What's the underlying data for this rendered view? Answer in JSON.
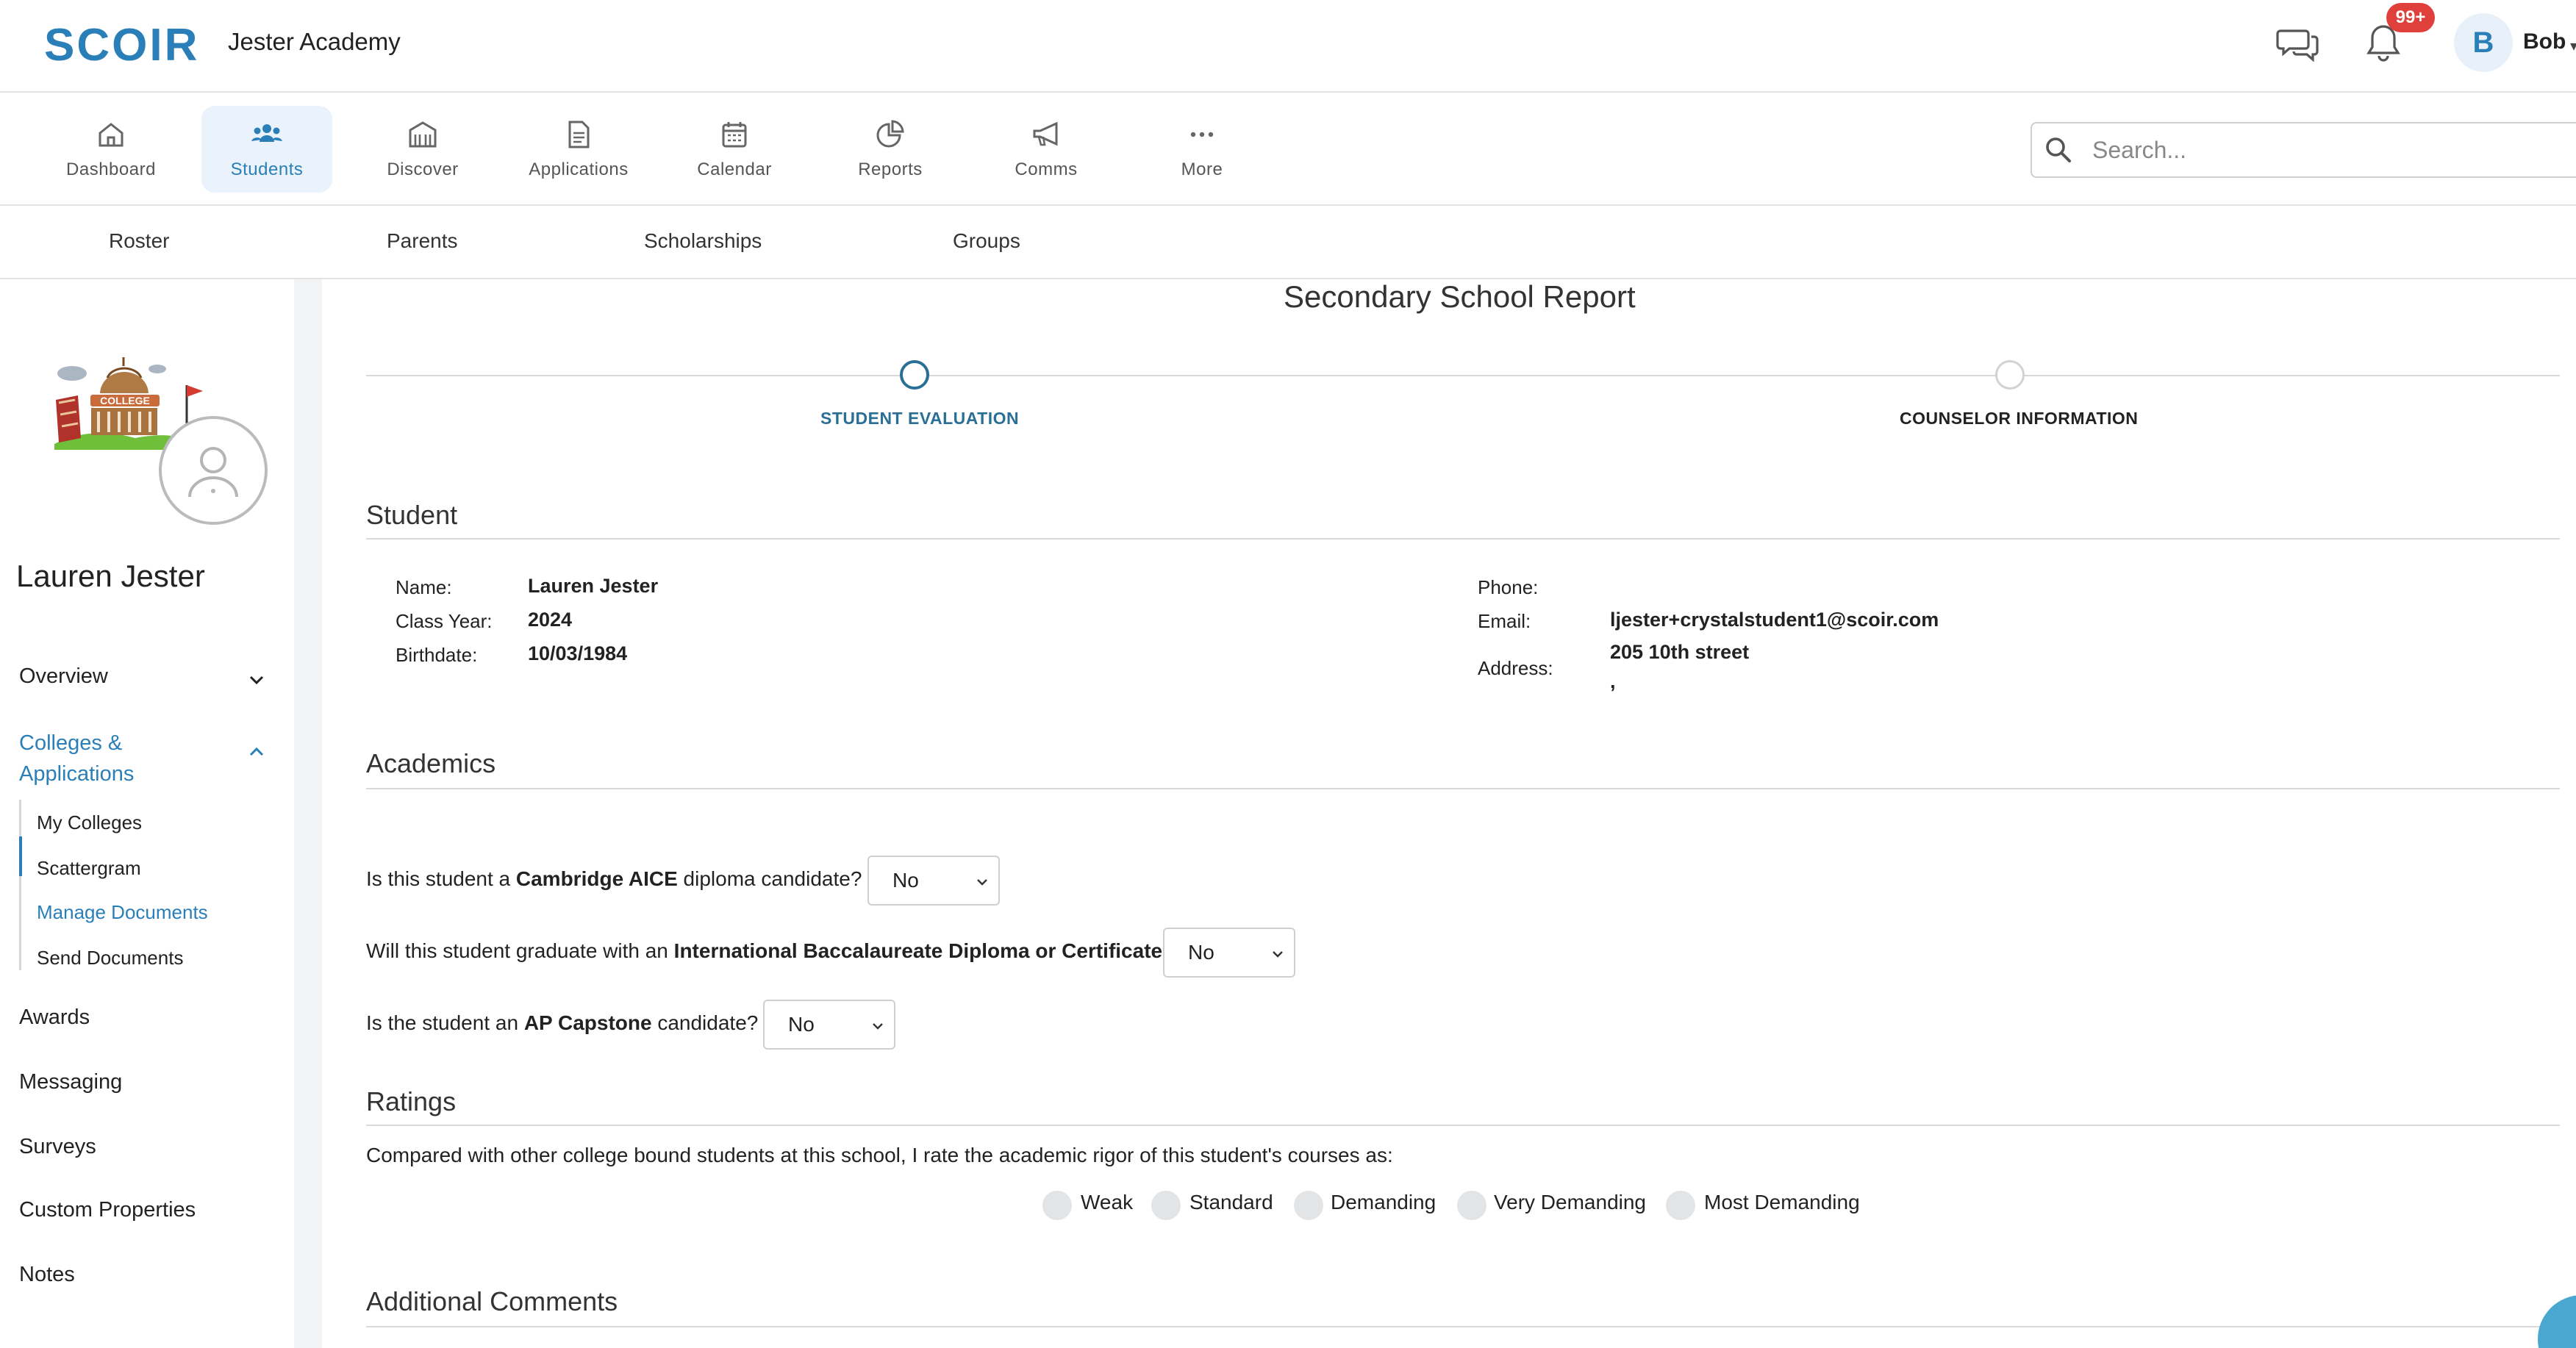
{
  "app": {
    "logo": "SCOIR",
    "org_name": "Jester Academy"
  },
  "header": {
    "notifications_count": "99+",
    "user_initial": "B",
    "user_name": "Bob",
    "user_caret": "▾"
  },
  "main_nav": {
    "items": [
      {
        "label": "Dashboard",
        "icon": "home-icon"
      },
      {
        "label": "Students",
        "icon": "users-icon",
        "active": true
      },
      {
        "label": "Discover",
        "icon": "building-icon"
      },
      {
        "label": "Applications",
        "icon": "document-icon"
      },
      {
        "label": "Calendar",
        "icon": "calendar-icon"
      },
      {
        "label": "Reports",
        "icon": "pie-chart-icon"
      },
      {
        "label": "Comms",
        "icon": "megaphone-icon"
      },
      {
        "label": "More",
        "icon": "more-dots-icon"
      }
    ],
    "search_placeholder": "Search..."
  },
  "sub_nav": {
    "items": [
      "Roster",
      "Parents",
      "Scholarships",
      "Groups"
    ]
  },
  "sidebar": {
    "student_name": "Lauren Jester",
    "links": {
      "overview": "Overview",
      "colleges_applications": "Colleges & Applications",
      "awards": "Awards",
      "messaging": "Messaging",
      "surveys": "Surveys",
      "custom_properties": "Custom Properties",
      "notes": "Notes"
    },
    "sub_links": [
      "My Colleges",
      "Scattergram",
      "Manage Documents",
      "Send Documents"
    ],
    "active_sub_link": "Manage Documents"
  },
  "report": {
    "title": "Secondary School Report",
    "steps": [
      {
        "label": "STUDENT EVALUATION",
        "state": "current"
      },
      {
        "label": "COUNSELOR INFORMATION",
        "state": "future"
      }
    ]
  },
  "student_section": {
    "title": "Student",
    "name_label": "Name:",
    "name_value": "Lauren Jester",
    "class_year_label": "Class Year:",
    "class_year_value": "2024",
    "birthdate_label": "Birthdate:",
    "birthdate_value": "10/03/1984",
    "phone_label": "Phone:",
    "phone_value": "",
    "email_label": "Email:",
    "email_value": "ljester+crystalstudent1@scoir.com",
    "address_label": "Address:",
    "address_line1": "205 10th street",
    "address_line2": ","
  },
  "academics": {
    "title": "Academics",
    "q1": {
      "before": "Is this student a ",
      "bold": "Cambridge AICE",
      "after": " diploma candidate?",
      "value": "No"
    },
    "q2": {
      "before": "Will this student graduate with an ",
      "bold": "International Baccalaureate Diploma or Certificate",
      "after": "?",
      "value": "No"
    },
    "q3": {
      "before": "Is the student an ",
      "bold": "AP Capstone",
      "after": " candidate?",
      "value": "No"
    }
  },
  "ratings": {
    "title": "Ratings",
    "question": "Compared with other college bound students at this school, I rate the academic rigor of this student's courses as:",
    "options": [
      "Weak",
      "Standard",
      "Demanding",
      "Very Demanding",
      "Most Demanding"
    ]
  },
  "additional_comments": {
    "title": "Additional Comments"
  },
  "colors": {
    "brand": "#2a7fb8",
    "active_step": "#2a6f96",
    "badge": "#e0403b"
  }
}
